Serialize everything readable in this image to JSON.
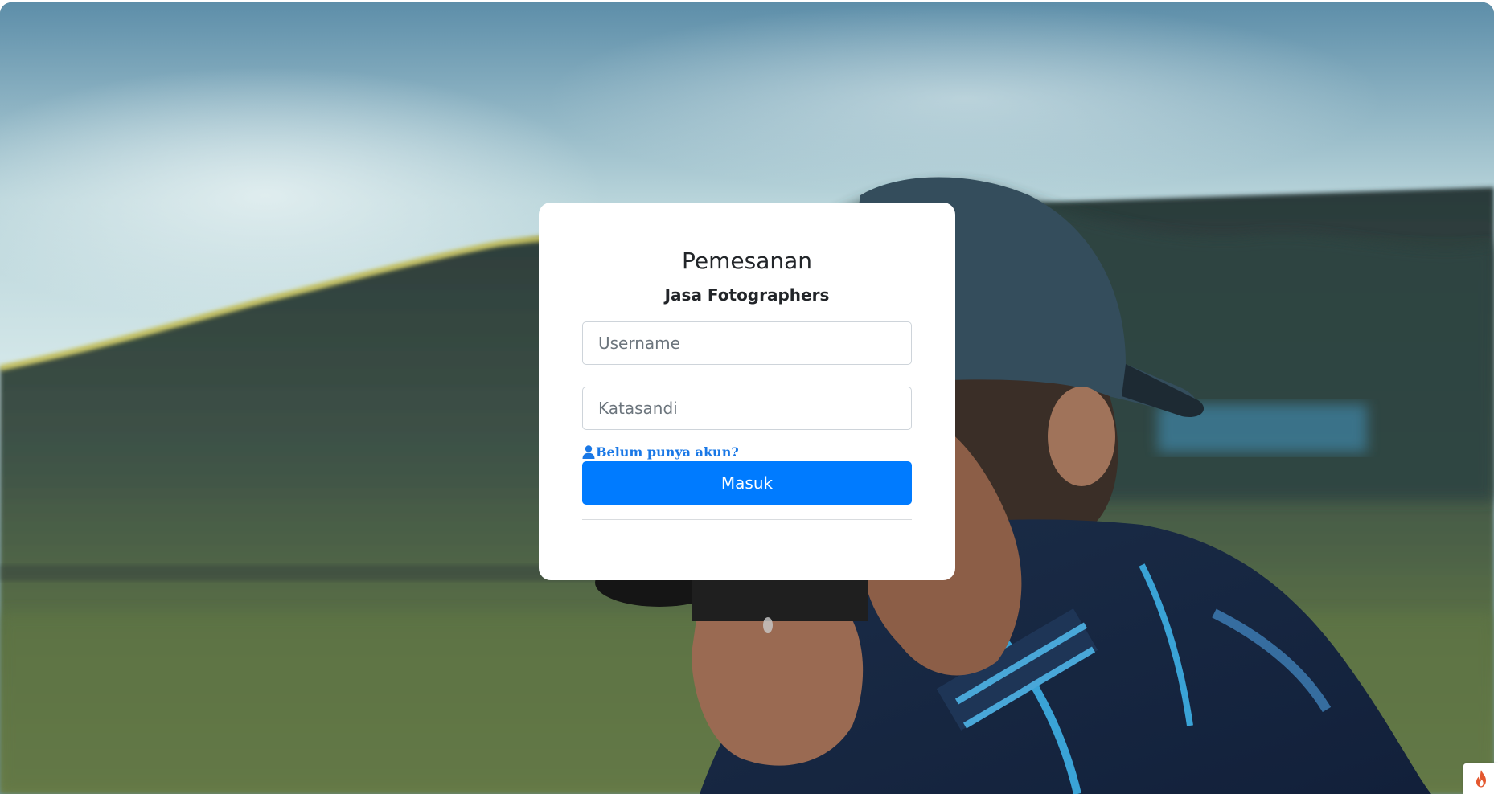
{
  "login": {
    "title": "Pemesanan",
    "subtitle": "Jasa Fotographers",
    "username_placeholder": "Username",
    "password_placeholder": "Katasandi",
    "register_link": "Belum punya akun?",
    "submit_label": "Masuk"
  },
  "icons": {
    "register": "user-icon",
    "corner_badge": "flame-icon"
  },
  "colors": {
    "primary": "#007bff",
    "link": "#1a78e6",
    "badge_flame": "#e4572e"
  }
}
